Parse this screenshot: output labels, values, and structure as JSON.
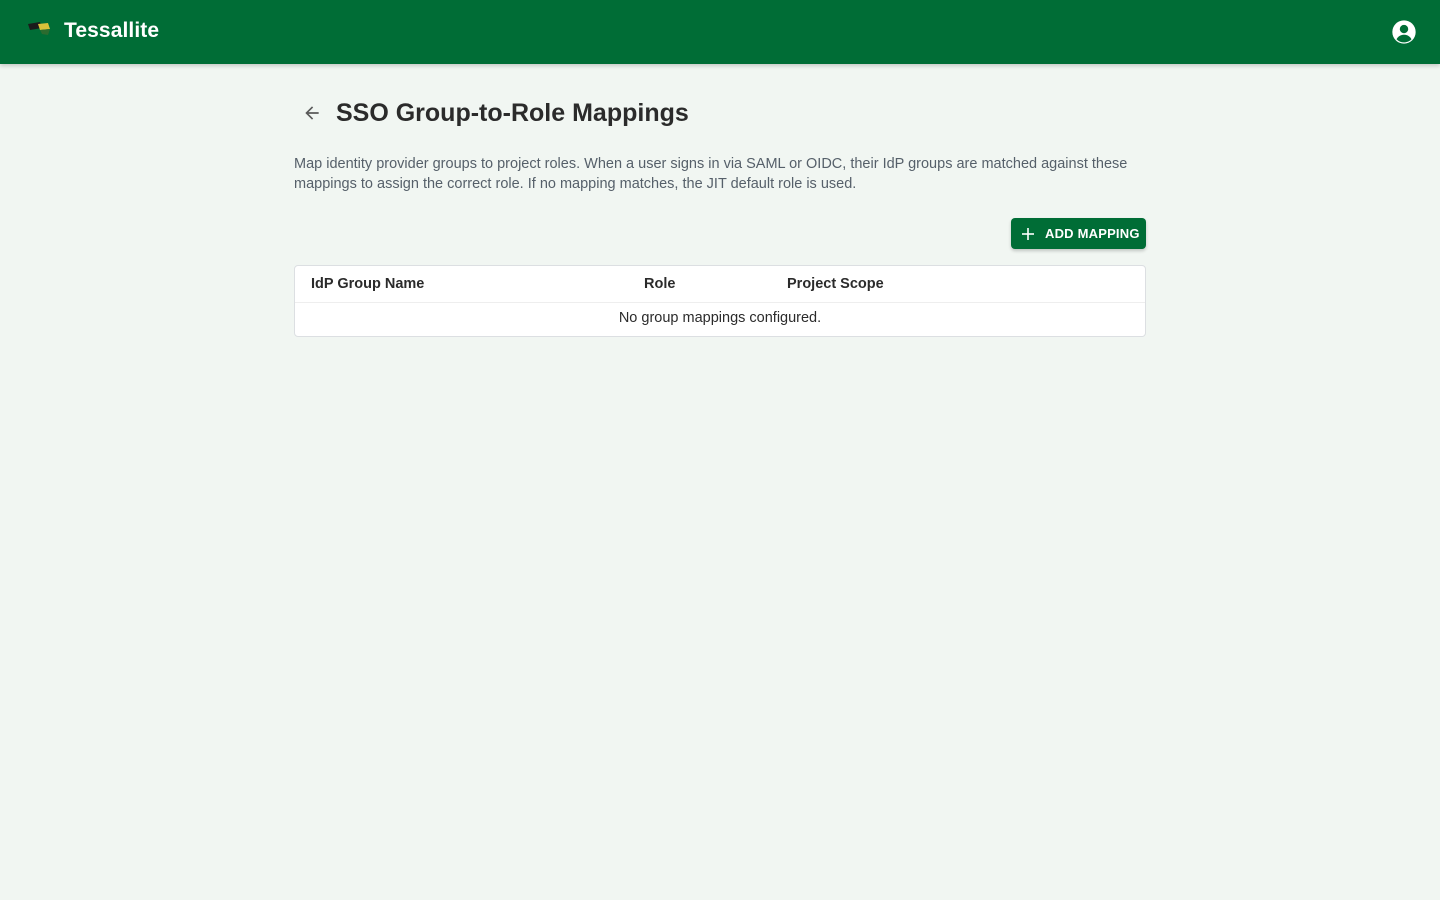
{
  "app": {
    "name": "Tessallite",
    "brand_color": "#006d36"
  },
  "header": {
    "account_icon": "account-circle-icon"
  },
  "page": {
    "title": "SSO Group-to-Role Mappings",
    "back_icon": "arrow-left-icon",
    "description": "Map identity provider groups to project roles. When a user signs in via SAML or OIDC, their IdP groups are matched against these mappings to assign the correct role. If no mapping matches, the JIT default role is used."
  },
  "toolbar": {
    "add_label": "ADD MAPPING",
    "add_icon": "plus-icon"
  },
  "table": {
    "columns": [
      "IdP Group Name",
      "Role",
      "Project Scope"
    ],
    "rows": [],
    "empty_message": "No group mappings configured."
  }
}
